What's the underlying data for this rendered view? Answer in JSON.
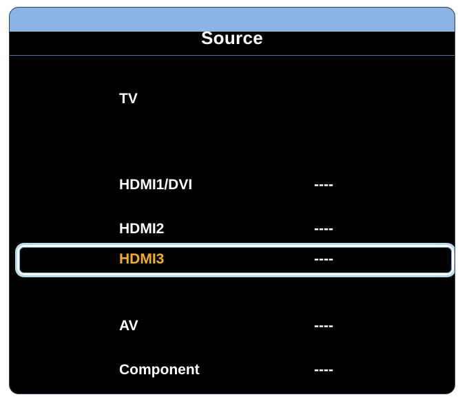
{
  "menu": {
    "title": "Source",
    "selected_index": 4,
    "items": [
      {
        "label": "TV",
        "status": ""
      },
      {
        "label": "",
        "status": ""
      },
      {
        "label": "HDMI1/DVI",
        "status": "----"
      },
      {
        "label": "HDMI2",
        "status": "----"
      },
      {
        "label": "HDMI3",
        "status": "----"
      },
      {
        "label": "AV",
        "status": "----"
      },
      {
        "label": "Component",
        "status": "----"
      }
    ]
  },
  "colors": {
    "title_bar": "#8db3e2",
    "background": "#000000",
    "text": "#ffffff",
    "selected_text": "#f2b01e",
    "selection_border": "#ffffff",
    "selection_glow": "#b7dde8"
  }
}
